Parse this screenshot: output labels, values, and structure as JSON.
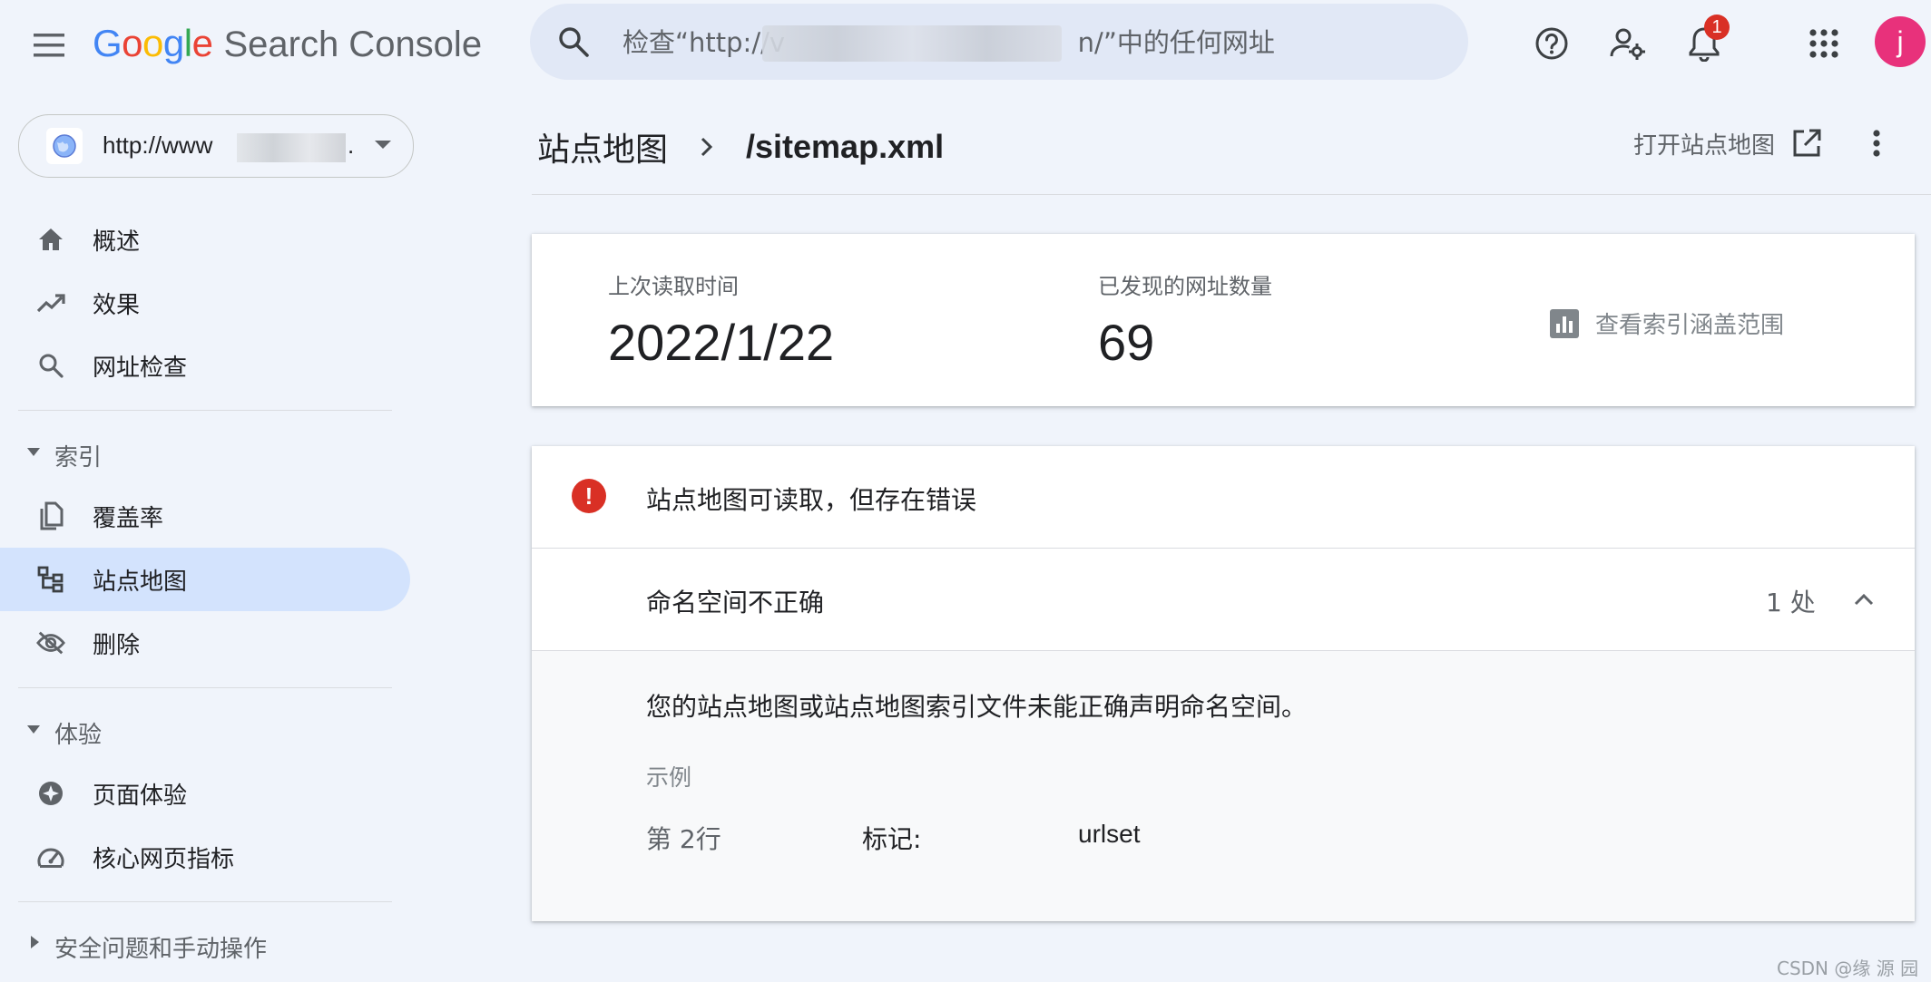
{
  "header": {
    "logo_google": "Google",
    "product_name": "Search Console",
    "search_placeholder": "检查“http://v                                   n/”中的任何网址",
    "notification_count": "1",
    "avatar_letter": "j"
  },
  "sidebar": {
    "property_url": "http://www",
    "property_suffix": ".",
    "items_top": [
      {
        "label": "概述"
      },
      {
        "label": "效果"
      },
      {
        "label": "网址检查"
      }
    ],
    "section_index": "索引",
    "items_index": [
      {
        "label": "覆盖率"
      },
      {
        "label": "站点地图"
      },
      {
        "label": "删除"
      }
    ],
    "section_experience": "体验",
    "items_experience": [
      {
        "label": "页面体验"
      },
      {
        "label": "核心网页指标"
      }
    ],
    "section_security": "安全问题和手动操作"
  },
  "main": {
    "breadcrumb_parent": "站点地图",
    "breadcrumb_current": "/sitemap.xml",
    "open_sitemap_label": "打开站点地图",
    "stats": {
      "last_read_label": "上次读取时间",
      "last_read_value": "2022/1/22",
      "discovered_label": "已发现的网址数量",
      "discovered_value": "69",
      "coverage_link": "查看索引涵盖范围"
    },
    "error": {
      "title": "站点地图可读取，但存在错误",
      "issue_name": "命名空间不正确",
      "issue_count": "1 处",
      "description": "您的站点地图或站点地图索引文件未能正确声明命名空间。",
      "example_label": "示例",
      "example_line": "第 2行",
      "example_tag_label": "标记:",
      "example_tag_value": "urlset"
    }
  },
  "watermark": "CSDN @缘  源  园",
  "colors": {
    "background": "#f0f4fb",
    "active_nav": "#d3e3fd",
    "error_red": "#d93025",
    "avatar": "#e8317b",
    "search_bg": "#e1e8f6"
  }
}
